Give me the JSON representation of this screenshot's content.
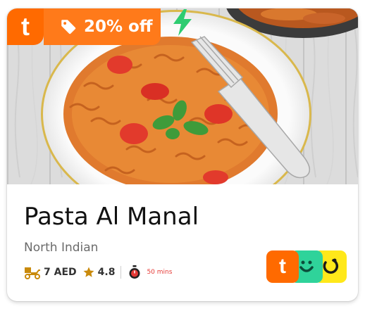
{
  "badge": {
    "brand_letter": "t",
    "brand_icon": "talabat-logo-icon",
    "tag_icon": "tag-icon",
    "offer_text": "20% off",
    "express_icon": "lightning-bolt-icon"
  },
  "restaurant": {
    "name": "Pasta Al Manal",
    "cuisine": "North Indian"
  },
  "meta": {
    "delivery_icon": "delivery-scooter-icon",
    "delivery_fee": "7 AED",
    "rating_icon": "star-icon",
    "rating": "4.8",
    "time_icon": "stopwatch-icon",
    "delivery_time": "50 mins"
  },
  "apps": [
    {
      "icon": "talabat-app-icon",
      "letter": "t"
    },
    {
      "icon": "careem-app-icon"
    },
    {
      "icon": "deliveroo-app-icon"
    }
  ],
  "colors": {
    "brand_orange": "#ff6a00",
    "offer_orange": "#ff7a1a",
    "bolt_green": "#2ecc71",
    "time_red": "#e53935",
    "star_gold": "#c98a0c"
  }
}
